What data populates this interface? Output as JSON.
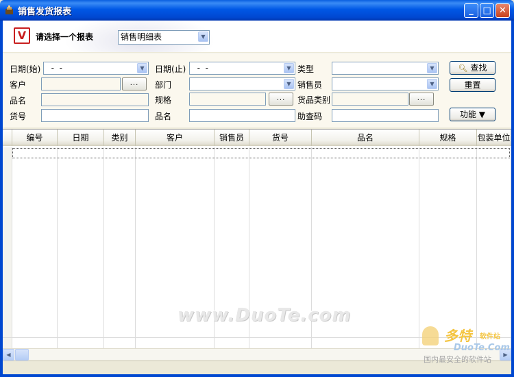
{
  "window": {
    "title": "销售发货报表",
    "min_label": "_",
    "max_label": "□",
    "close_label": "✕"
  },
  "header": {
    "logo_letter": "V",
    "select_label": "请选择一个报表",
    "report_select_value": "销售明细表"
  },
  "filters": {
    "date_start_label": "日期(始)",
    "date_start_value": "  -  -",
    "date_end_label": "日期(止)",
    "date_end_value": "  -  -",
    "type_label": "类型",
    "customer_label": "客户",
    "department_label": "部门",
    "salesperson_label": "销售员",
    "product_name_label": "品名",
    "spec_label": "规格",
    "category_label": "货品类别",
    "item_no_label": "货号",
    "product_name2_label": "品名",
    "lookup_code_label": "助查码",
    "dots_label": "..."
  },
  "actions": {
    "search_label": "查找",
    "reset_label": "重置",
    "function_label": "功能 ▼"
  },
  "grid": {
    "columns": [
      "编号",
      "日期",
      "类别",
      "客户",
      "销售员",
      "货号",
      "品名",
      "规格",
      "包装单位"
    ]
  },
  "watermark": {
    "text": "www.DuoTe.com",
    "corner_name": "多特",
    "corner_sub": "软件站",
    "corner_en": "DuoTe.Com",
    "corner_slogan": "国内最安全的软件站"
  },
  "icons": {
    "app": "app-icon",
    "search": "magnifier-icon",
    "combo": "chevron-down-icon"
  }
}
